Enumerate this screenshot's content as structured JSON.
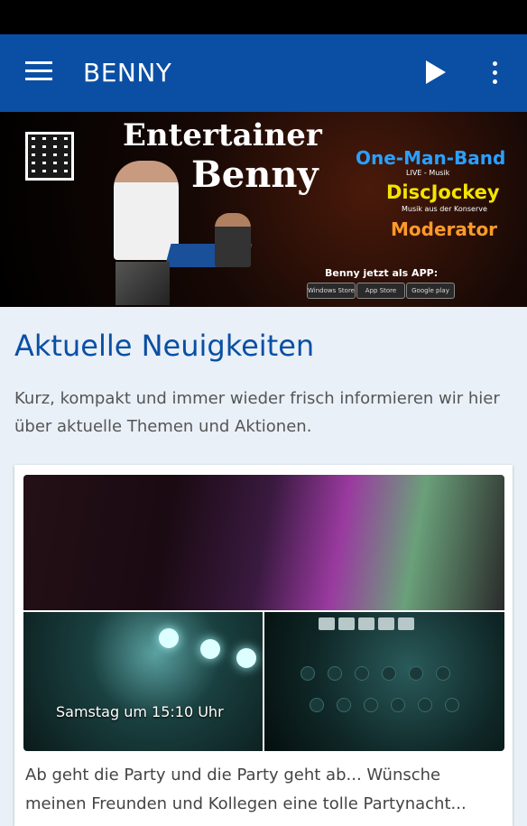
{
  "app": {
    "title": "BENNY"
  },
  "icons": {
    "menu": "hamburger-menu-icon",
    "play": "play-icon",
    "more": "more-vert-icon"
  },
  "colors": {
    "appbar": "#0a4fa3",
    "accent": "#0a4fa3",
    "background": "#e9f0f8"
  },
  "banner": {
    "title_line1": "Entertainer",
    "title_line2": "Benny",
    "role1": "One-Man-Band",
    "role1_sub": "LIVE - Musik",
    "role2": "DiscJockey",
    "role2_sub": "Musik aus der Konserve",
    "role3": "Moderator",
    "app_note": "Benny jetzt als APP:",
    "stores": [
      "Windows Store",
      "App Store",
      "Google play"
    ]
  },
  "section": {
    "title": "Aktuelle Neuigkeiten",
    "description": "Kurz, kompakt und immer wieder frisch informieren wir hier über aktuelle Themen und Aktionen."
  },
  "post": {
    "timestamp": "Samstag um 15:10 Uhr",
    "text": "Ab geht die Party und die Party geht ab... Wünsche meinen Freunden und Kollegen eine tolle Partynacht..."
  }
}
